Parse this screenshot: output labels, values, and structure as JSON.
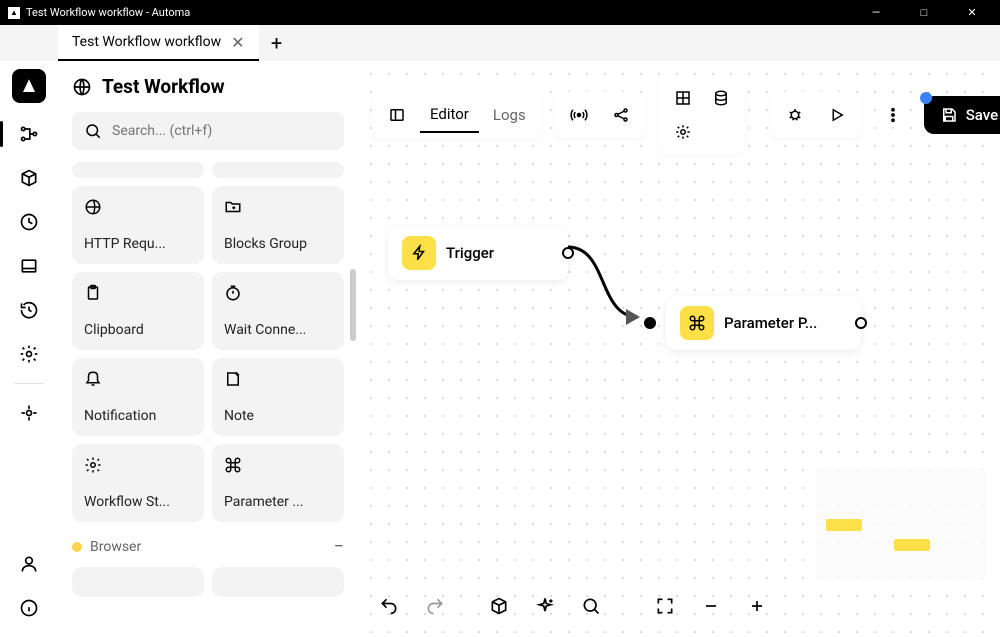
{
  "window": {
    "title": "Test Workflow workflow - Automa"
  },
  "tabs": {
    "active": "Test Workflow workflow"
  },
  "workflow": {
    "title": "Test Workflow"
  },
  "search": {
    "placeholder": "Search... (ctrl+f)"
  },
  "blocks": {
    "http": "HTTP Requ...",
    "blocks_group": "Blocks Group",
    "clipboard": "Clipboard",
    "wait_conn": "Wait Conne...",
    "notification": "Notification",
    "note": "Note",
    "workflow_st": "Workflow St...",
    "parameter": "Parameter ..."
  },
  "categories": {
    "browser": "Browser"
  },
  "canvas_tabs": {
    "editor": "Editor",
    "logs": "Logs"
  },
  "toolbar": {
    "save": "Save"
  },
  "nodes": {
    "trigger": "Trigger",
    "parameter": "Parameter P..."
  }
}
